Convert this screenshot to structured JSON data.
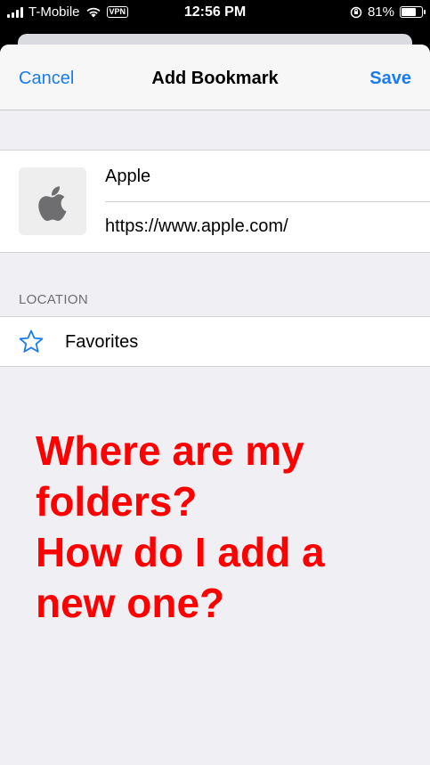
{
  "status_bar": {
    "carrier": "T-Mobile",
    "vpn": "VPN",
    "time": "12:56 PM",
    "battery_percent": "81%",
    "battery_level": 0.81
  },
  "nav": {
    "cancel_label": "Cancel",
    "title": "Add Bookmark",
    "save_label": "Save"
  },
  "bookmark": {
    "title_value": "Apple",
    "url_value": "https://www.apple.com/",
    "icon": "apple-logo-icon"
  },
  "location": {
    "section_label": "LOCATION",
    "selected": "Favorites",
    "icon": "star-icon"
  },
  "annotation": {
    "line1": "Where are my",
    "line2": "folders?",
    "line3": "How do I add a",
    "line4": "new one?"
  },
  "colors": {
    "accent": "#1a7cf0",
    "annotation": "#ff0000",
    "background": "#efeff4"
  }
}
